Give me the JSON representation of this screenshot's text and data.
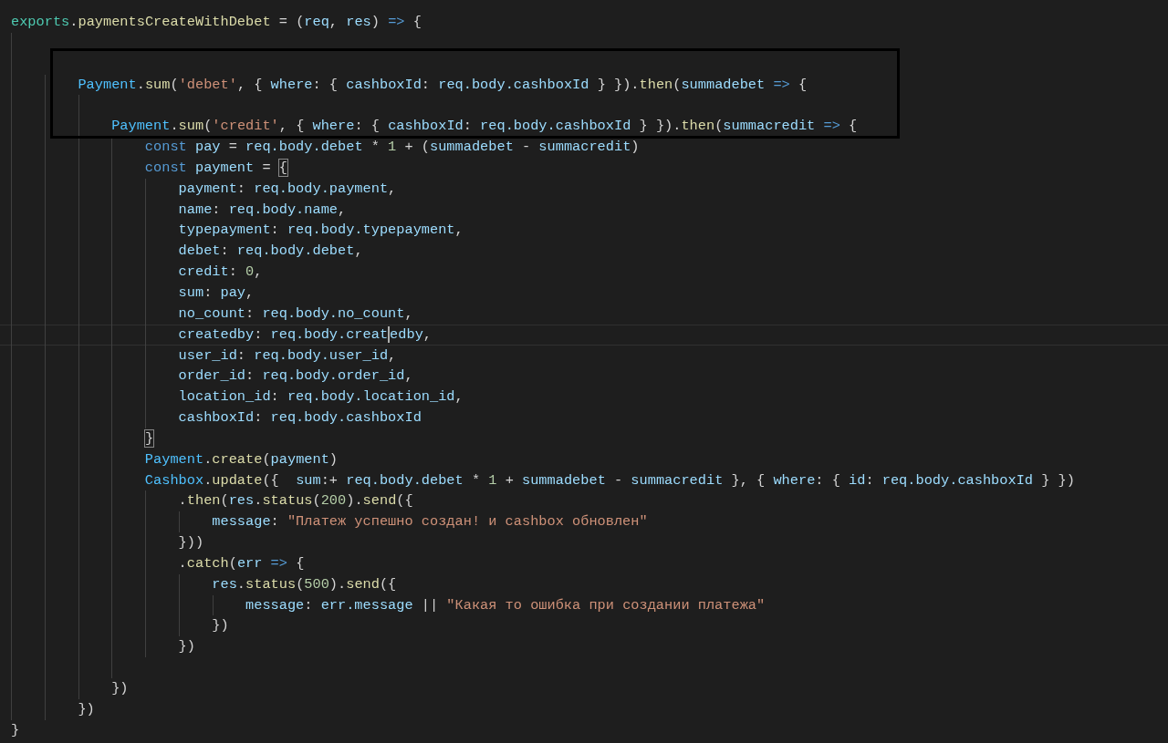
{
  "lines": [
    {
      "kind": "code",
      "tokens": [
        {
          "kind": "module",
          "text": "exports"
        },
        {
          "kind": "plain",
          "text": "."
        },
        {
          "kind": "function",
          "text": "paymentsCreateWithDebet"
        },
        {
          "kind": "plain",
          "text": " = ("
        },
        {
          "kind": "variable",
          "text": "req"
        },
        {
          "kind": "plain",
          "text": ", "
        },
        {
          "kind": "variable",
          "text": "res"
        },
        {
          "kind": "plain",
          "text": ") "
        },
        {
          "kind": "keyword",
          "text": "=>"
        },
        {
          "kind": "plain",
          "text": " {"
        }
      ]
    },
    {
      "kind": "blank"
    },
    {
      "kind": "blank",
      "framed": true
    },
    {
      "kind": "code",
      "framed": true,
      "tokens": [
        {
          "kind": "constant",
          "text": "        Payment"
        },
        {
          "kind": "plain",
          "text": "."
        },
        {
          "kind": "function",
          "text": "sum"
        },
        {
          "kind": "plain",
          "text": "("
        },
        {
          "kind": "string",
          "text": "'debet'"
        },
        {
          "kind": "plain",
          "text": ", { "
        },
        {
          "kind": "variable",
          "text": "where"
        },
        {
          "kind": "plain",
          "text": ": { "
        },
        {
          "kind": "variable",
          "text": "cashboxId"
        },
        {
          "kind": "plain",
          "text": ": "
        },
        {
          "kind": "variable",
          "text": "req.body.cashboxId"
        },
        {
          "kind": "plain",
          "text": " } })."
        },
        {
          "kind": "function",
          "text": "then"
        },
        {
          "kind": "plain",
          "text": "("
        },
        {
          "kind": "variable",
          "text": "summadebet "
        },
        {
          "kind": "keyword",
          "text": "=>"
        },
        {
          "kind": "plain",
          "text": " {"
        }
      ]
    },
    {
      "kind": "blank",
      "framed": true
    },
    {
      "kind": "code",
      "framed": true,
      "tokens": [
        {
          "kind": "constant",
          "text": "            Payment"
        },
        {
          "kind": "plain",
          "text": "."
        },
        {
          "kind": "function",
          "text": "sum"
        },
        {
          "kind": "plain",
          "text": "("
        },
        {
          "kind": "string",
          "text": "'credit'"
        },
        {
          "kind": "plain",
          "text": ", { "
        },
        {
          "kind": "variable",
          "text": "where"
        },
        {
          "kind": "plain",
          "text": ": { "
        },
        {
          "kind": "variable",
          "text": "cashboxId"
        },
        {
          "kind": "plain",
          "text": ": "
        },
        {
          "kind": "variable",
          "text": "req.body.cashboxId"
        },
        {
          "kind": "plain",
          "text": " } })."
        },
        {
          "kind": "function",
          "text": "then"
        },
        {
          "kind": "plain",
          "text": "("
        },
        {
          "kind": "variable",
          "text": "summacredit "
        },
        {
          "kind": "keyword",
          "text": "=>"
        },
        {
          "kind": "plain",
          "text": " {"
        }
      ]
    },
    {
      "kind": "code",
      "tokens": [
        {
          "kind": "keyword",
          "text": "                const "
        },
        {
          "kind": "variable",
          "text": "pay"
        },
        {
          "kind": "plain",
          "text": " = "
        },
        {
          "kind": "variable",
          "text": "req.body.debet"
        },
        {
          "kind": "plain",
          "text": " * "
        },
        {
          "kind": "number",
          "text": "1"
        },
        {
          "kind": "plain",
          "text": " + ("
        },
        {
          "kind": "variable",
          "text": "summadebet"
        },
        {
          "kind": "plain",
          "text": " - "
        },
        {
          "kind": "variable",
          "text": "summacredit"
        },
        {
          "kind": "plain",
          "text": ")"
        }
      ]
    },
    {
      "kind": "code",
      "tokens": [
        {
          "kind": "keyword",
          "text": "                const "
        },
        {
          "kind": "variable",
          "text": "payment"
        },
        {
          "kind": "plain",
          "text": " = "
        },
        {
          "kind": "bracket_match",
          "text": "{"
        }
      ]
    },
    {
      "kind": "code",
      "tokens": [
        {
          "kind": "variable",
          "text": "                    payment"
        },
        {
          "kind": "plain",
          "text": ": "
        },
        {
          "kind": "variable",
          "text": "req.body.payment"
        },
        {
          "kind": "plain",
          "text": ","
        }
      ]
    },
    {
      "kind": "code",
      "tokens": [
        {
          "kind": "variable",
          "text": "                    name"
        },
        {
          "kind": "plain",
          "text": ": "
        },
        {
          "kind": "variable",
          "text": "req.body.name"
        },
        {
          "kind": "plain",
          "text": ","
        }
      ]
    },
    {
      "kind": "code",
      "tokens": [
        {
          "kind": "variable",
          "text": "                    typepayment"
        },
        {
          "kind": "plain",
          "text": ": "
        },
        {
          "kind": "variable",
          "text": "req.body.typepayment"
        },
        {
          "kind": "plain",
          "text": ","
        }
      ]
    },
    {
      "kind": "code",
      "tokens": [
        {
          "kind": "variable",
          "text": "                    debet"
        },
        {
          "kind": "plain",
          "text": ": "
        },
        {
          "kind": "variable",
          "text": "req.body.debet"
        },
        {
          "kind": "plain",
          "text": ","
        }
      ]
    },
    {
      "kind": "code",
      "tokens": [
        {
          "kind": "variable",
          "text": "                    credit"
        },
        {
          "kind": "plain",
          "text": ": "
        },
        {
          "kind": "number",
          "text": "0"
        },
        {
          "kind": "plain",
          "text": ","
        }
      ]
    },
    {
      "kind": "code",
      "tokens": [
        {
          "kind": "variable",
          "text": "                    sum"
        },
        {
          "kind": "plain",
          "text": ": "
        },
        {
          "kind": "variable",
          "text": "pay"
        },
        {
          "kind": "plain",
          "text": ","
        }
      ]
    },
    {
      "kind": "code",
      "tokens": [
        {
          "kind": "variable",
          "text": "                    no_count"
        },
        {
          "kind": "plain",
          "text": ": "
        },
        {
          "kind": "variable",
          "text": "req.body.no_count"
        },
        {
          "kind": "plain",
          "text": ","
        }
      ]
    },
    {
      "kind": "code",
      "current": true,
      "tokens": [
        {
          "kind": "variable",
          "text": "                    createdby"
        },
        {
          "kind": "plain",
          "text": ": "
        },
        {
          "kind": "variable",
          "text": "req.body.creat"
        },
        {
          "kind": "cursor"
        },
        {
          "kind": "variable",
          "text": "edby"
        },
        {
          "kind": "plain",
          "text": ","
        }
      ]
    },
    {
      "kind": "code",
      "tokens": [
        {
          "kind": "variable",
          "text": "                    user_id"
        },
        {
          "kind": "plain",
          "text": ": "
        },
        {
          "kind": "variable",
          "text": "req.body.user_id"
        },
        {
          "kind": "plain",
          "text": ","
        }
      ]
    },
    {
      "kind": "code",
      "tokens": [
        {
          "kind": "variable",
          "text": "                    order_id"
        },
        {
          "kind": "plain",
          "text": ": "
        },
        {
          "kind": "variable",
          "text": "req.body.order_id"
        },
        {
          "kind": "plain",
          "text": ","
        }
      ]
    },
    {
      "kind": "code",
      "tokens": [
        {
          "kind": "variable",
          "text": "                    location_id"
        },
        {
          "kind": "plain",
          "text": ": "
        },
        {
          "kind": "variable",
          "text": "req.body.location_id"
        },
        {
          "kind": "plain",
          "text": ","
        }
      ]
    },
    {
      "kind": "code",
      "tokens": [
        {
          "kind": "variable",
          "text": "                    cashboxId"
        },
        {
          "kind": "plain",
          "text": ": "
        },
        {
          "kind": "variable",
          "text": "req.body.cashboxId"
        }
      ]
    },
    {
      "kind": "code",
      "tokens": [
        {
          "kind": "bracket_match",
          "text": "                }"
        }
      ]
    },
    {
      "kind": "code",
      "tokens": [
        {
          "kind": "constant",
          "text": "                Payment"
        },
        {
          "kind": "plain",
          "text": "."
        },
        {
          "kind": "function",
          "text": "create"
        },
        {
          "kind": "plain",
          "text": "("
        },
        {
          "kind": "variable",
          "text": "payment"
        },
        {
          "kind": "plain",
          "text": ")"
        }
      ]
    },
    {
      "kind": "code",
      "tokens": [
        {
          "kind": "constant",
          "text": "                Cashbox"
        },
        {
          "kind": "plain",
          "text": "."
        },
        {
          "kind": "function",
          "text": "update"
        },
        {
          "kind": "plain",
          "text": "({  "
        },
        {
          "kind": "variable",
          "text": "sum"
        },
        {
          "kind": "plain",
          "text": ":+ "
        },
        {
          "kind": "variable",
          "text": "req.body.debet"
        },
        {
          "kind": "plain",
          "text": " * "
        },
        {
          "kind": "number",
          "text": "1"
        },
        {
          "kind": "plain",
          "text": " + "
        },
        {
          "kind": "variable",
          "text": "summadebet"
        },
        {
          "kind": "plain",
          "text": " - "
        },
        {
          "kind": "variable",
          "text": "summacredit"
        },
        {
          "kind": "plain",
          "text": " }, { "
        },
        {
          "kind": "variable",
          "text": "where"
        },
        {
          "kind": "plain",
          "text": ": { "
        },
        {
          "kind": "variable",
          "text": "id"
        },
        {
          "kind": "plain",
          "text": ": "
        },
        {
          "kind": "variable",
          "text": "req.body.cashboxId"
        },
        {
          "kind": "plain",
          "text": " } })"
        }
      ]
    },
    {
      "kind": "code",
      "tokens": [
        {
          "kind": "plain",
          "text": "                    ."
        },
        {
          "kind": "function",
          "text": "then"
        },
        {
          "kind": "plain",
          "text": "("
        },
        {
          "kind": "variable",
          "text": "res"
        },
        {
          "kind": "plain",
          "text": "."
        },
        {
          "kind": "function",
          "text": "status"
        },
        {
          "kind": "plain",
          "text": "("
        },
        {
          "kind": "number",
          "text": "200"
        },
        {
          "kind": "plain",
          "text": ")."
        },
        {
          "kind": "function",
          "text": "send"
        },
        {
          "kind": "plain",
          "text": "({"
        }
      ]
    },
    {
      "kind": "code",
      "tokens": [
        {
          "kind": "variable",
          "text": "                        message"
        },
        {
          "kind": "plain",
          "text": ": "
        },
        {
          "kind": "string",
          "text": "\"Платеж успешно создан! и cashbox обновлен\""
        }
      ]
    },
    {
      "kind": "code",
      "tokens": [
        {
          "kind": "plain",
          "text": "                    }))"
        }
      ]
    },
    {
      "kind": "code",
      "tokens": [
        {
          "kind": "plain",
          "text": "                    ."
        },
        {
          "kind": "function",
          "text": "catch"
        },
        {
          "kind": "plain",
          "text": "("
        },
        {
          "kind": "variable",
          "text": "err "
        },
        {
          "kind": "keyword",
          "text": "=>"
        },
        {
          "kind": "plain",
          "text": " {"
        }
      ]
    },
    {
      "kind": "code",
      "tokens": [
        {
          "kind": "variable",
          "text": "                        res"
        },
        {
          "kind": "plain",
          "text": "."
        },
        {
          "kind": "function",
          "text": "status"
        },
        {
          "kind": "plain",
          "text": "("
        },
        {
          "kind": "number",
          "text": "500"
        },
        {
          "kind": "plain",
          "text": ")."
        },
        {
          "kind": "function",
          "text": "send"
        },
        {
          "kind": "plain",
          "text": "({"
        }
      ]
    },
    {
      "kind": "code",
      "tokens": [
        {
          "kind": "variable",
          "text": "                            message"
        },
        {
          "kind": "plain",
          "text": ": "
        },
        {
          "kind": "variable",
          "text": "err.message"
        },
        {
          "kind": "plain",
          "text": " || "
        },
        {
          "kind": "string",
          "text": "\"Какая то ошибка при создании платежа\""
        }
      ]
    },
    {
      "kind": "code",
      "tokens": [
        {
          "kind": "plain",
          "text": "                        })"
        }
      ]
    },
    {
      "kind": "code",
      "tokens": [
        {
          "kind": "plain",
          "text": "                    })"
        }
      ]
    },
    {
      "kind": "blank"
    },
    {
      "kind": "code",
      "tokens": [
        {
          "kind": "plain",
          "text": "            })"
        }
      ]
    },
    {
      "kind": "code",
      "tokens": [
        {
          "kind": "plain",
          "text": "        })"
        }
      ]
    },
    {
      "kind": "code",
      "tokens": [
        {
          "kind": "plain",
          "text": "}"
        }
      ]
    }
  ]
}
